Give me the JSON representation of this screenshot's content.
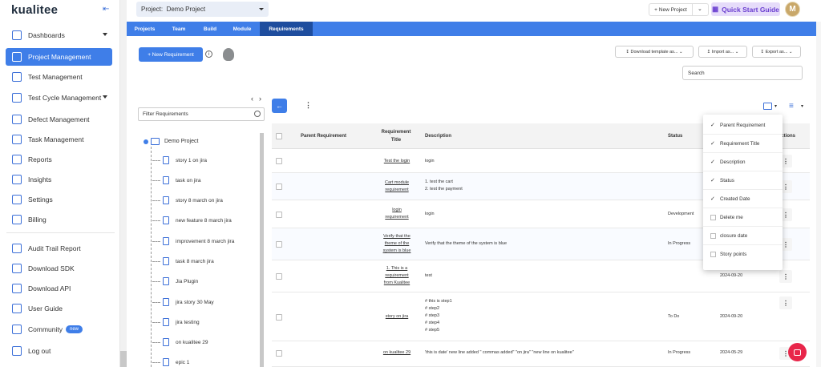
{
  "brand": {
    "logo": "kualitee",
    "collapse_icon": "collapse-sidebar-icon"
  },
  "sidebar": {
    "items": [
      {
        "label": "Dashboards",
        "icon": "dashboard-icon",
        "has_caret": true
      },
      {
        "label": "Project Management",
        "icon": "project-management-icon",
        "active": true
      },
      {
        "label": "Test Management",
        "icon": "test-management-icon"
      },
      {
        "label": "Test Cycle Management",
        "icon": "test-cycle-icon",
        "has_caret": true
      },
      {
        "label": "Defect Management",
        "icon": "defect-icon"
      },
      {
        "label": "Task Management",
        "icon": "task-icon"
      },
      {
        "label": "Reports",
        "icon": "reports-icon"
      },
      {
        "label": "Insights",
        "icon": "insights-icon"
      },
      {
        "label": "Settings",
        "icon": "settings-icon"
      },
      {
        "label": "Billing",
        "icon": "billing-icon"
      },
      {
        "label": "Audit Trail Report",
        "icon": "audit-icon"
      },
      {
        "label": "Download SDK",
        "icon": "sdk-icon"
      },
      {
        "label": "Download API",
        "icon": "api-icon"
      },
      {
        "label": "User Guide",
        "icon": "guide-icon"
      },
      {
        "label": "Community",
        "icon": "community-icon",
        "badge": "new"
      },
      {
        "label": "Log out",
        "icon": "logout-icon"
      }
    ]
  },
  "topbar": {
    "project_label": "Project:",
    "project_value": "Demo Project",
    "new_project": "+ New Project",
    "quick_start": "Quick Start Guide",
    "avatar_initial": "M"
  },
  "tabs": [
    "Projects",
    "Team",
    "Build",
    "Module",
    "Requirements"
  ],
  "toolbar": {
    "new_requirement": "+ New Requirement",
    "download_template": "Download template as...",
    "import": "Import as...",
    "export": "Export as...",
    "search_placeholder": "Search"
  },
  "tree": {
    "filter_placeholder": "Filter Requirements",
    "root": "Demo Project",
    "nodes": [
      "story 1 on jira",
      "task on jira",
      "story 8 march on jira",
      "new feature 8 march jira",
      "improvement 8 march jira",
      "task 8 march jira",
      "Jia Plugin",
      "jira story 30 May",
      "jira testing",
      "on kualitee 29",
      "epic 1"
    ]
  },
  "table": {
    "headers": {
      "parent": "Parent Requirement",
      "title": "Requirement Title",
      "description": "Description",
      "status": "Status",
      "actions": "Actions"
    },
    "rows": [
      {
        "title": [
          "Test the login"
        ],
        "description": [
          "login"
        ],
        "status": "",
        "date": ""
      },
      {
        "title": [
          "Cart module",
          "requirement"
        ],
        "description": [
          "1. test the cart",
          "2. test the payment"
        ],
        "status": "",
        "date": ""
      },
      {
        "title": [
          "login",
          "requirement"
        ],
        "description": [
          "login"
        ],
        "status": "Development",
        "date": ""
      },
      {
        "title": [
          "Verify that the",
          "theme of the",
          "system is blue"
        ],
        "description": [
          "Verify that the theme of the system is blue"
        ],
        "status": "In Progress",
        "date": ""
      },
      {
        "title": [
          "1. This is a",
          "requirement",
          "from Kualitee"
        ],
        "description": [
          "test"
        ],
        "status": "",
        "date": "2024-09-20"
      },
      {
        "title": [
          "story on jira"
        ],
        "description": [
          "# this is step1",
          "# step2",
          "# step3",
          "# step4",
          "# step5"
        ],
        "status": "To Do",
        "date": "2024-09-20"
      },
      {
        "title": [
          "on kualitee 29"
        ],
        "description": [
          "'this is date' new line added \" commas added\" \"on jira\" \"new line on kualitee\""
        ],
        "status": "In Progress",
        "date": "2024-05-29"
      }
    ]
  },
  "column_menu": [
    {
      "label": "Parent Requirement",
      "checked": true
    },
    {
      "label": "Requirement Title",
      "checked": true
    },
    {
      "label": "Description",
      "checked": true
    },
    {
      "label": "Status",
      "checked": true
    },
    {
      "label": "Created Date",
      "checked": true
    },
    {
      "label": "Delete me",
      "checked": false
    },
    {
      "label": "closure date",
      "checked": false
    },
    {
      "label": "Story points",
      "checked": false
    }
  ]
}
